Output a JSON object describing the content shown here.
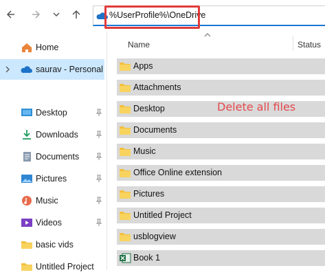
{
  "toolbar": {
    "back_icon": "arrow-left-icon",
    "forward_icon": "arrow-right-icon",
    "recent_icon": "chevron-down-icon",
    "up_icon": "arrow-up-icon"
  },
  "address_bar": {
    "value": "%UserProfile%\\OneDrive",
    "icon": "onedrive-cloud-icon"
  },
  "sidebar": {
    "items": [
      {
        "label": "Home",
        "icon": "home-icon"
      },
      {
        "label": "saurav - Personal",
        "icon": "onedrive-cloud-icon"
      },
      {
        "label": "Desktop",
        "icon": "desktop-icon"
      },
      {
        "label": "Downloads",
        "icon": "downloads-icon"
      },
      {
        "label": "Documents",
        "icon": "documents-icon"
      },
      {
        "label": "Pictures",
        "icon": "pictures-icon"
      },
      {
        "label": "Music",
        "icon": "music-icon"
      },
      {
        "label": "Videos",
        "icon": "videos-icon"
      },
      {
        "label": "basic vids",
        "icon": "folder-icon"
      },
      {
        "label": "Untitled Project",
        "icon": "folder-icon"
      }
    ]
  },
  "file_list": {
    "columns": {
      "name": "Name",
      "status": "Status"
    },
    "rows": [
      {
        "name": "Apps",
        "icon": "folder-icon"
      },
      {
        "name": "Attachments",
        "icon": "folder-icon"
      },
      {
        "name": "Desktop",
        "icon": "folder-icon"
      },
      {
        "name": "Documents",
        "icon": "folder-icon"
      },
      {
        "name": "Music",
        "icon": "folder-icon"
      },
      {
        "name": "Office Online extension",
        "icon": "folder-icon"
      },
      {
        "name": "Pictures",
        "icon": "folder-icon"
      },
      {
        "name": "Untitled Project",
        "icon": "folder-icon"
      },
      {
        "name": "usblogview",
        "icon": "folder-icon"
      },
      {
        "name": "Book 1",
        "icon": "excel-file-icon"
      }
    ]
  },
  "annotation": {
    "text": "Delete all files",
    "color": "#e5484d"
  },
  "colors": {
    "selection": "#cce8ff",
    "row_selected": "#d9d9d9",
    "folder": "#f2c040",
    "highlight": "#e03a3a"
  }
}
